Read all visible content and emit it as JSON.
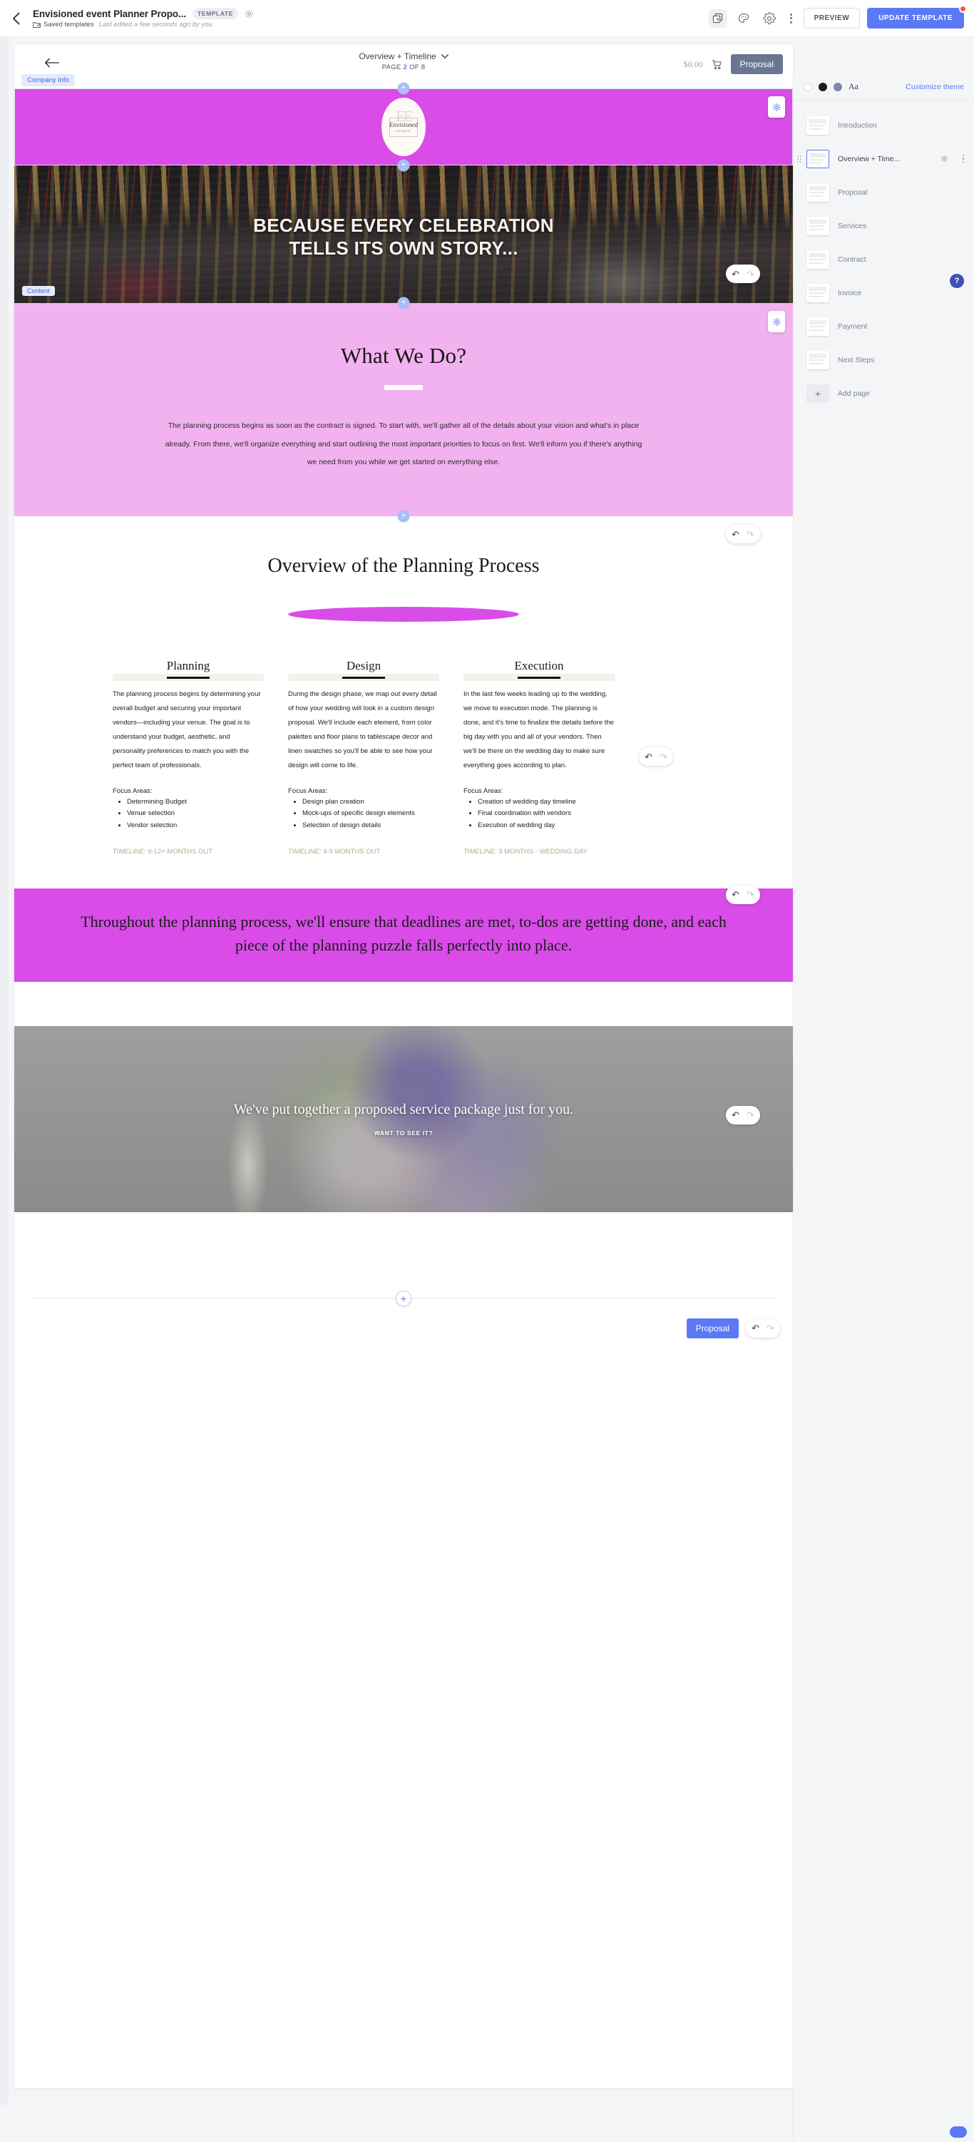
{
  "appbar": {
    "back_icon": "chevron-left-icon",
    "doc_title": "Envisioned event Planner Propo...",
    "template_badge": "TEMPLATE",
    "saved_templates": "Saved templates",
    "last_edited": "Last edited a few seconds ago by you",
    "pages_icon_count": "8",
    "preview_label": "PREVIEW",
    "update_label": "UPDATE TEMPLATE"
  },
  "canvas_toolbar": {
    "back_icon": "arrow-left-icon",
    "company_chip": "Company info",
    "page_name": "Overview + Timeline",
    "page_count_prefix": "PAGE",
    "page_number": "2",
    "page_count_suffix": "OF 8",
    "price": "$0.00",
    "cart_icon": "cart-icon",
    "proposal_label": "Proposal"
  },
  "document": {
    "logo": {
      "monogram": "EE",
      "script": "Envisioned",
      "sub": "EVENTS"
    },
    "hero": {
      "line1": "BECAUSE EVERY CELEBRATION",
      "line2": "TELLS ITS OWN STORY..."
    },
    "what_we_do": {
      "title": "What We Do?",
      "body": "The planning process begins as soon as the contract is signed. To start with, we'll gather all of the details about your vision and what's in place already. From there, we'll organize everything and start outlining the most important priorities to focus on first. We'll inform you if there's anything we need from you while we get started on everything else."
    },
    "overview": {
      "title": "Overview of the Planning Process",
      "columns": [
        {
          "name": "Planning",
          "body": "The planning process begins by determining your overall budget and securing your important vendors—including your venue. The goal is to understand your budget, aesthetic, and personality preferences to match you with the perfect team of professionals.",
          "focus_label": "Focus Areas:",
          "focus_items": [
            "Determining Budget",
            "Venue selection",
            "Vendor selection"
          ],
          "timeline_label": "TIMELINE:",
          "timeline_value": "9-12+ MONTHS OUT"
        },
        {
          "name": "Design",
          "body": "During the design phase, we map out every detail of how your wedding will look in a custom design proposal. We'll include each element, from color palettes and floor plans to tablescape decor and linen swatches so you'll be able to see how your design will come to life.",
          "focus_label": "Focus Areas:",
          "focus_items": [
            "Design plan creation",
            "Mock-ups of specific design elements",
            "Selection of design details"
          ],
          "timeline_label": "TIMELINE:",
          "timeline_value": "4-9 MONTHS OUT"
        },
        {
          "name": "Execution",
          "body": "In the last few weeks leading up to the wedding, we move to execution mode. The planning is done, and it's time to finalize the details before the big day with you and all of your vendors. Then we'll be there on the wedding day to make sure everything goes according to plan.",
          "focus_label": "Focus Areas:",
          "focus_items": [
            "Creation of wedding day timeline",
            "Final coordination with vendors",
            "Execution of wedding day"
          ],
          "timeline_label": "TIMELINE:",
          "timeline_value": "3 MONTHS - WEDDING DAY"
        }
      ]
    },
    "quote": "Throughout the planning process, we'll ensure that deadlines are met, to-dos are getting done, and each piece of the planning puzzle falls perfectly into place.",
    "flowers": {
      "heading": "We've put together a proposed service package just for you.",
      "sub": "WANT TO SEE IT?"
    },
    "content_chip": "Content",
    "footer_proposal_label": "Proposal"
  },
  "right_panel": {
    "customize_theme": "Customize theme",
    "aa_label": "Aa",
    "swatches": [
      "#ffffff",
      "#1b1b1b",
      "#7b86b5"
    ],
    "pages": [
      {
        "label": "Introduction",
        "selected": false
      },
      {
        "label": "Overview + Time...",
        "selected": true
      },
      {
        "label": "Proposal",
        "selected": false
      },
      {
        "label": "Services",
        "selected": false
      },
      {
        "label": "Contract",
        "selected": false
      },
      {
        "label": "Invoice",
        "selected": false
      },
      {
        "label": "Payment",
        "selected": false
      },
      {
        "label": "Next Steps",
        "selected": false
      }
    ],
    "add_page": "Add page",
    "help_label": "?"
  },
  "theme": {
    "accent_blue": "#5b79f5",
    "magenta": "#d94ce8",
    "pink": "#f2b2ef",
    "tan": "#b9a78c"
  }
}
